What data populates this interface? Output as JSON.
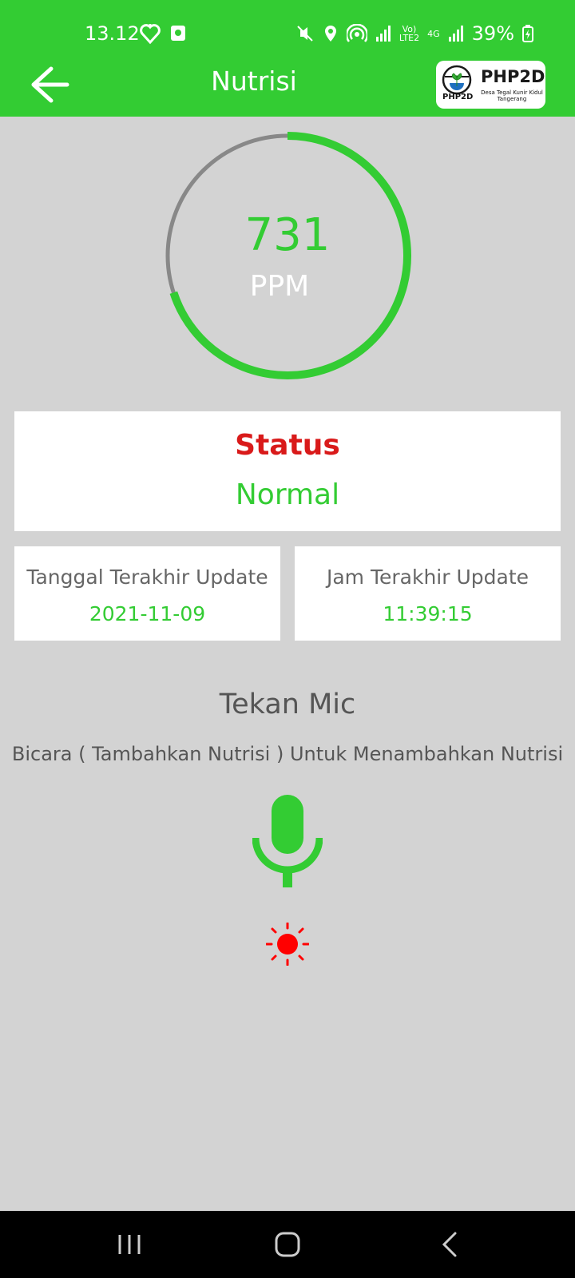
{
  "status_bar": {
    "time": "13.12",
    "battery": "39%",
    "volte": "Vo)\nLTE2",
    "network": "4G"
  },
  "app_bar": {
    "title": "Nutrisi",
    "logo": {
      "text": "PHP2D",
      "small_text": "PHP2D",
      "subtitle": "Desa Tegal Kunir Kidul Tangerang"
    }
  },
  "gauge": {
    "value": "731",
    "unit": "PPM",
    "fraction": 0.7,
    "fill_color": "#33cc33",
    "track_color": "#888888"
  },
  "status_card": {
    "title": "Status",
    "value": "Normal"
  },
  "date_card": {
    "label": "Tanggal Terakhir Update",
    "value": "2021-11-09"
  },
  "time_card": {
    "label": "Jam Terakhir Update",
    "value": "11:39:15"
  },
  "mic_section": {
    "title": "Tekan Mic",
    "description": "Bicara ( Tambahkan Nutrisi ) Untuk Menambahkan Nutrisi"
  },
  "icons": {
    "mic": "microphone-icon",
    "indicator": "sun-icon",
    "back": "arrow-left-icon"
  },
  "colors": {
    "primary": "#33cc33",
    "background": "#d3d3d3",
    "status_title": "#d91a1a",
    "indicator": "#ff0000"
  }
}
